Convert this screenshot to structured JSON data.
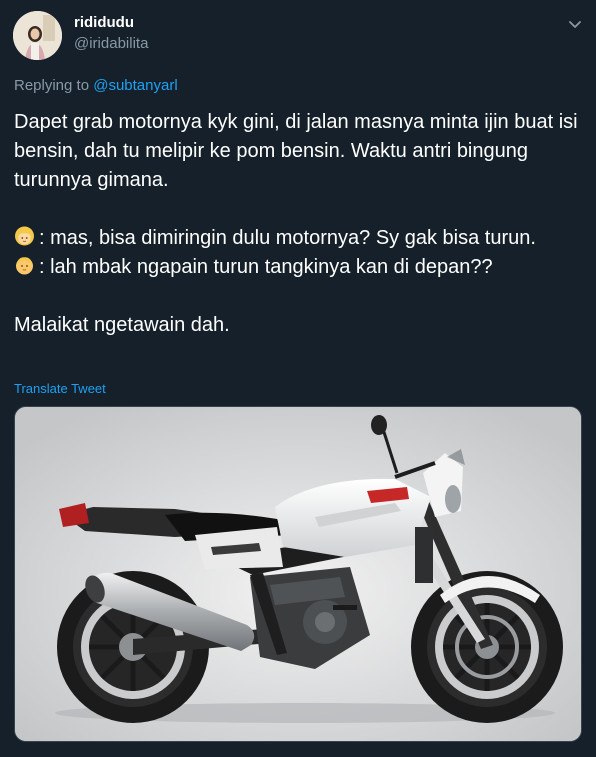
{
  "user": {
    "display_name": "rididudu",
    "handle": "@iridabilita"
  },
  "reply": {
    "prefix": "Replying to",
    "mention": "@subtanyarl"
  },
  "tweet": {
    "line1": "Dapet grab motornya kyk gini, di jalan masnya minta ijin buat isi bensin, dah tu melipir ke pom bensin. Waktu antri bingung turunnya gimana.",
    "line2": ": mas, bisa dimiringin dulu motornya? Sy gak bisa turun.",
    "line3": ": lah mbak ngapain turun tangkinya kan di depan??",
    "line4": "Malaikat ngetawain dah.",
    "emoji1": "woman-emoji",
    "emoji2": "man-emoji"
  },
  "translate_label": "Translate Tweet",
  "colors": {
    "background": "#15202b",
    "link": "#1da1f2",
    "secondary": "#8899a6"
  }
}
